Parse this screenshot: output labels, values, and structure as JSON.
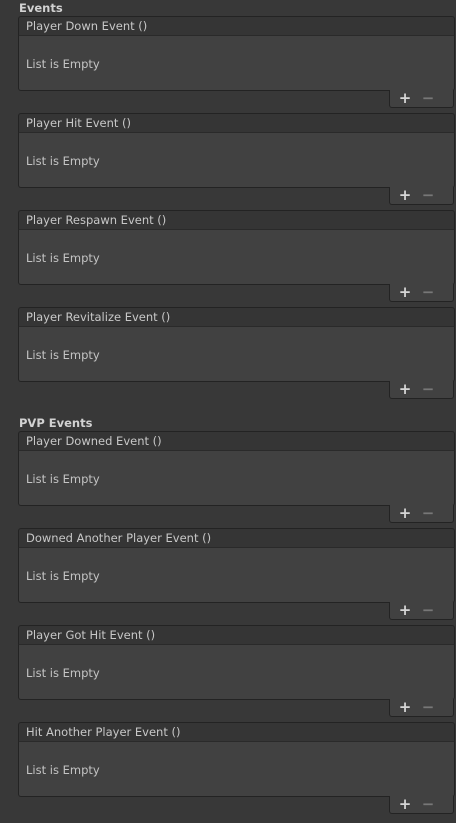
{
  "sections": [
    {
      "header": "Events",
      "events": [
        {
          "title": "Player Down Event ()",
          "empty_text": "List is Empty",
          "add_glyph": "+",
          "remove_glyph": "−"
        },
        {
          "title": "Player Hit Event ()",
          "empty_text": "List is Empty",
          "add_glyph": "+",
          "remove_glyph": "−"
        },
        {
          "title": "Player Respawn Event ()",
          "empty_text": "List is Empty",
          "add_glyph": "+",
          "remove_glyph": "−"
        },
        {
          "title": "Player Revitalize Event ()",
          "empty_text": "List is Empty",
          "add_glyph": "+",
          "remove_glyph": "−"
        }
      ]
    },
    {
      "header": "PVP Events",
      "events": [
        {
          "title": "Player Downed Event ()",
          "empty_text": "List is Empty",
          "add_glyph": "+",
          "remove_glyph": "−"
        },
        {
          "title": "Downed Another Player Event ()",
          "empty_text": "List is Empty",
          "add_glyph": "+",
          "remove_glyph": "−"
        },
        {
          "title": "Player Got Hit Event ()",
          "empty_text": "List is Empty",
          "add_glyph": "+",
          "remove_glyph": "−"
        },
        {
          "title": "Hit Another Player Event ()",
          "empty_text": "List is Empty",
          "add_glyph": "+",
          "remove_glyph": "−"
        }
      ]
    }
  ],
  "colors": {
    "background": "#383838",
    "header_bg": "#353535",
    "body_bg": "#414141",
    "border": "#232323",
    "text": "#c4c4c4",
    "plus": "#d6d6d6",
    "minus_disabled": "#777777"
  },
  "icons": {
    "add": "plus-icon",
    "remove": "minus-icon"
  }
}
